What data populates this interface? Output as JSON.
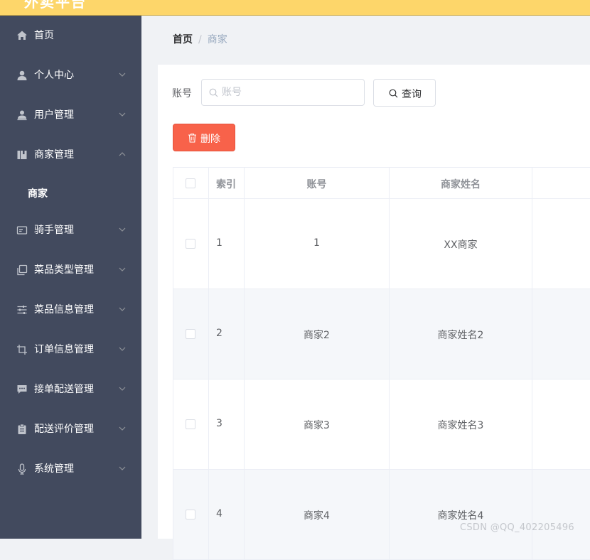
{
  "header": {
    "title": "外卖平台"
  },
  "breadcrumb": {
    "home": "首页",
    "separator": "/",
    "current": "商家"
  },
  "sidebar": {
    "items": [
      {
        "label": "首页",
        "icon": "home-icon"
      },
      {
        "label": "个人中心",
        "icon": "user-icon"
      },
      {
        "label": "用户管理",
        "icon": "user-manage-icon"
      },
      {
        "label": "商家管理",
        "icon": "shop-icon",
        "expanded": true
      },
      {
        "label": "骑手管理",
        "icon": "id-card-icon"
      },
      {
        "label": "菜品类型管理",
        "icon": "copy-icon"
      },
      {
        "label": "菜品信息管理",
        "icon": "sliders-icon"
      },
      {
        "label": "订单信息管理",
        "icon": "crop-icon"
      },
      {
        "label": "接单配送管理",
        "icon": "chat-icon"
      },
      {
        "label": "配送评价管理",
        "icon": "clipboard-icon"
      },
      {
        "label": "系统管理",
        "icon": "microphone-icon"
      }
    ],
    "sub_item": {
      "label": "商家"
    }
  },
  "search": {
    "label": "账号",
    "placeholder": "账号",
    "value": "",
    "button_label": "查询"
  },
  "actions": {
    "delete_label": "删除"
  },
  "table": {
    "columns": [
      "索引",
      "账号",
      "商家姓名"
    ],
    "rows": [
      {
        "index": "1",
        "account": "1",
        "name": "XX商家"
      },
      {
        "index": "2",
        "account": "商家2",
        "name": "商家姓名2"
      },
      {
        "index": "3",
        "account": "商家3",
        "name": "商家姓名3"
      },
      {
        "index": "4",
        "account": "商家4",
        "name": "商家姓名4"
      }
    ]
  },
  "watermark": "CSDN @QQ_402205496",
  "colors": {
    "topbar": "#fdd66a",
    "sidebar": "#424a5e",
    "delete_button": "#f8624a",
    "row_stripe": "#f5f7fa"
  }
}
